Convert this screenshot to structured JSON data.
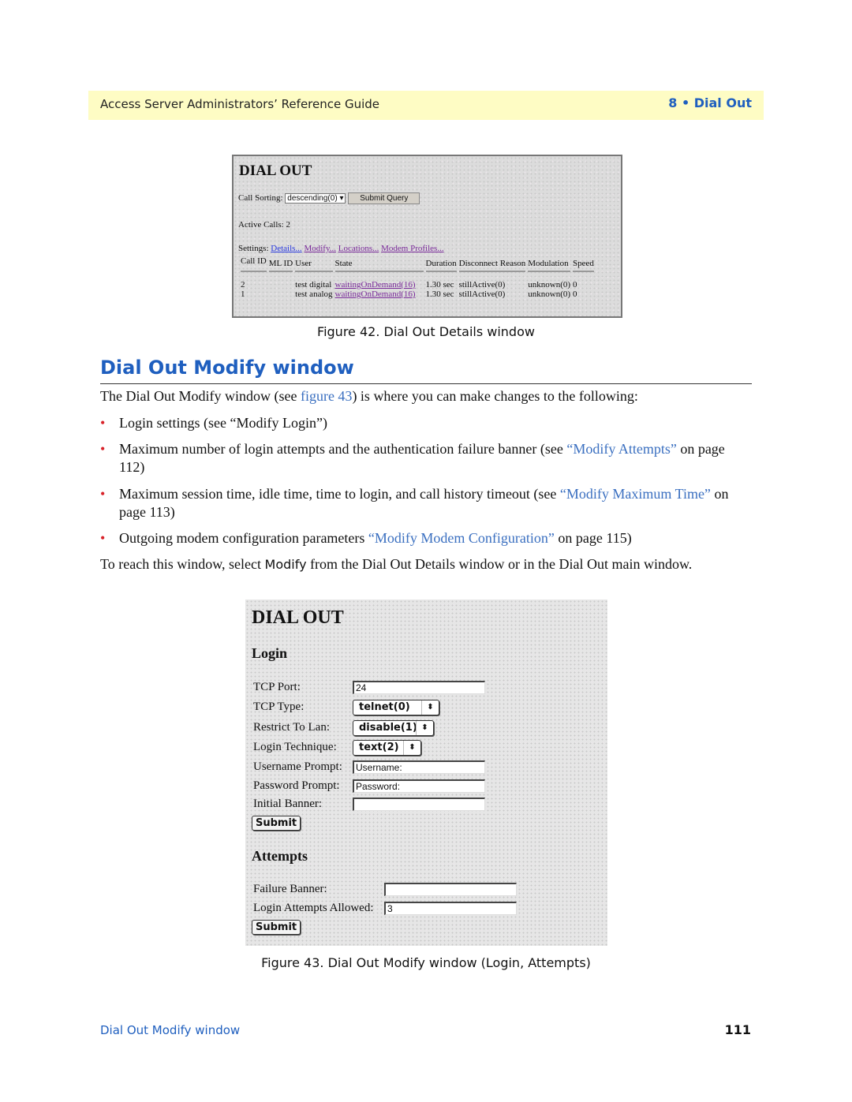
{
  "header": {
    "left": "Access Server Administrators’ Reference Guide",
    "right": "8 • Dial Out"
  },
  "fig42": {
    "title": "DIAL OUT",
    "call_sorting_label": "Call Sorting:",
    "call_sorting_value": "descending(0)",
    "submit_query": "Submit Query",
    "active_calls": "Active Calls: 2",
    "settings_label": "Settings:",
    "links": [
      "Details...",
      "Modify...",
      "Locations...",
      "Modem Profiles..."
    ],
    "columns": [
      "Call ID",
      "ML ID",
      "User",
      "State",
      "Duration",
      "Disconnect Reason",
      "Modulation",
      "Speed"
    ],
    "rows": [
      [
        "2",
        "",
        "test digital",
        "waitingOnDemand(16)",
        "1.30 sec",
        "stillActive(0)",
        "unknown(0)",
        "0"
      ],
      [
        "1",
        "",
        "test analog",
        "waitingOnDemand(16)",
        "1.30 sec",
        "stillActive(0)",
        "unknown(0)",
        "0"
      ]
    ],
    "caption": "Figure 42. Dial Out Details window"
  },
  "section": {
    "title": "Dial Out Modify window",
    "intro": {
      "a": "The Dial Out Modify window (see ",
      "link": "figure 43",
      "b": ") is where you can make changes to the following:"
    },
    "bullets": [
      {
        "a": "Login settings (see “Modify Login”)"
      },
      {
        "a": "Maximum number of login attempts and the authentication failure banner (see ",
        "link": "“Modify Attempts”",
        "b": " on page 112)"
      },
      {
        "a": "Maximum session time, idle time, time to login, and call history timeout (see ",
        "link": "“Modify Maximum Time”",
        "b": " on page 113)"
      },
      {
        "a": "Outgoing modem configuration parameters ",
        "link": "“Modify Modem Configuration”",
        "b": " on page 115)"
      }
    ],
    "outro": {
      "a": "To reach this window, select ",
      "b": "Modify",
      "c": " from the Dial Out Details window or in the Dial Out main window."
    }
  },
  "fig43": {
    "title": "DIAL OUT",
    "login_heading": "Login",
    "fields": {
      "tcp_port_label": "TCP Port:",
      "tcp_port": "24",
      "tcp_type_label": "TCP Type:",
      "tcp_type": "telnet(0)",
      "restrict_label": "Restrict To Lan:",
      "restrict": "disable(1)",
      "technique_label": "Login Technique:",
      "technique": "text(2)",
      "username_label": "Username Prompt:",
      "username": "Username:",
      "password_label": "Password Prompt:",
      "password": "Password:",
      "banner_label": "Initial Banner:",
      "banner": ""
    },
    "submit": "Submit",
    "attempts_heading": "Attempts",
    "failure_label": "Failure Banner:",
    "failure": "",
    "allowed_label": "Login Attempts Allowed:",
    "allowed": "3",
    "caption": "Figure 43. Dial Out Modify window (Login, Attempts)"
  },
  "footer": {
    "left": "Dial Out Modify window",
    "page": "111"
  }
}
